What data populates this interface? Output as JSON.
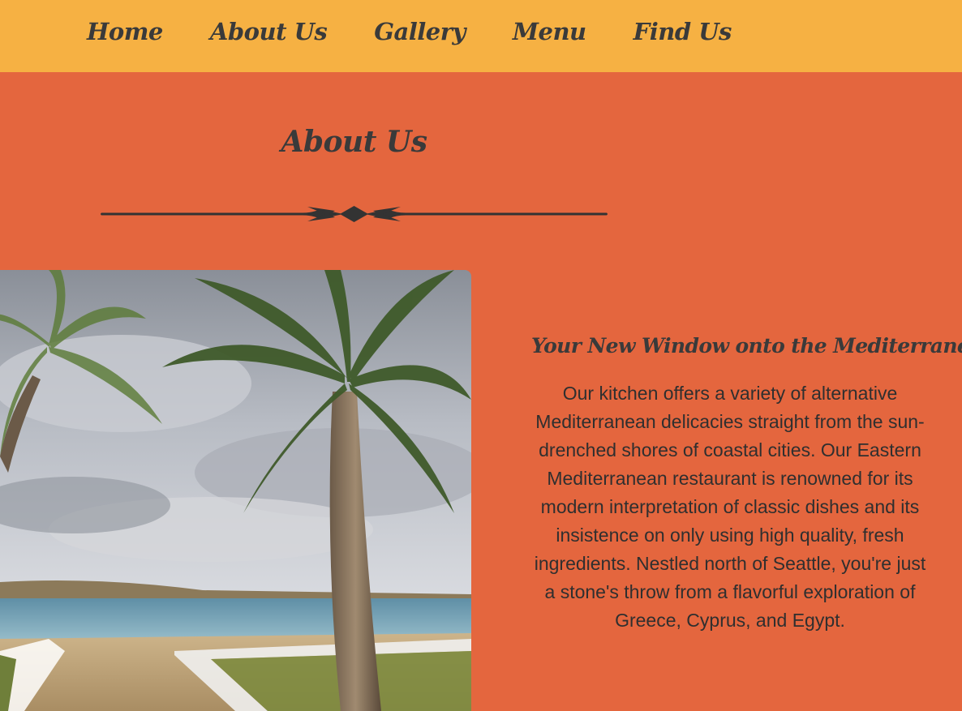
{
  "nav": {
    "items": [
      {
        "label": "Home"
      },
      {
        "label": "About Us"
      },
      {
        "label": "Gallery"
      },
      {
        "label": "Menu"
      },
      {
        "label": "Find Us"
      }
    ]
  },
  "page": {
    "title": "About Us"
  },
  "about": {
    "subtitle": "Your New Window onto the Mediterranean",
    "body": "Our kitchen offers a variety of alternative Mediterranean delicacies straight from the sun-drenched shores of coastal cities. Our Eastern Mediterranean restaurant is renowned for its modern interpretation of classic dishes and its insistence on only using high quality, fresh ingredients. Nestled north of Seattle, you're just a stone's throw from a flavorful exploration of Greece, Cyprus, and Egypt."
  },
  "colors": {
    "navbar": "#f6b143",
    "background": "#e4663e",
    "text": "#3a3a3a"
  }
}
